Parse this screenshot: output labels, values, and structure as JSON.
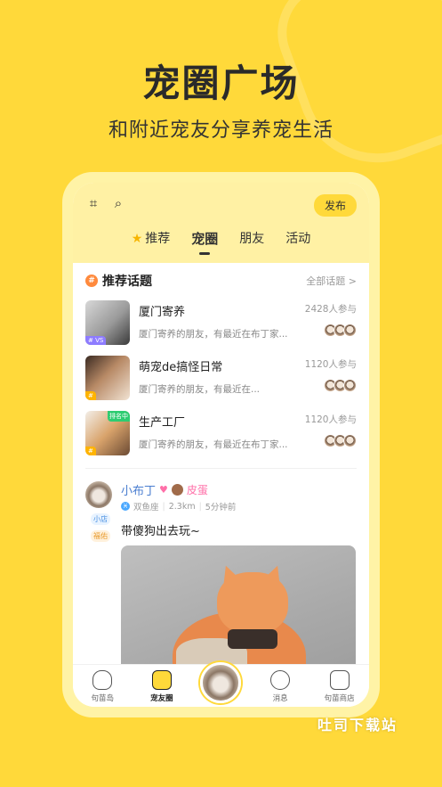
{
  "promo": {
    "title": "宠圈广场",
    "subtitle": "和附近宠友分享养宠生活"
  },
  "header": {
    "scan_icon": "scan-icon",
    "search_icon": "search-icon",
    "publish_label": "发布"
  },
  "tabs": [
    {
      "label": "推荐",
      "icon": "star-icon"
    },
    {
      "label": "宠圈",
      "active": true
    },
    {
      "label": "朋友"
    },
    {
      "label": "活动"
    }
  ],
  "topics_section": {
    "title": "推荐话题",
    "see_all": "全部话题 >",
    "items": [
      {
        "name": "厦门寄养",
        "desc": "厦门寄养的朋友，有最近在布丁家...",
        "count": "2428人参与",
        "tag": "# VS",
        "tag_color": "#8E7CFF"
      },
      {
        "name": "萌宠de搞怪日常",
        "desc": "厦门寄养的朋友，有最近在...",
        "count": "1120人参与",
        "tag": "#",
        "tag_color": "#FFB400"
      },
      {
        "name": "生产工厂",
        "desc": "厦门寄养的朋友，有最近在布丁家...",
        "count": "1120人参与",
        "tag": "#",
        "tag_color": "#FFB400",
        "hot": "排名中"
      }
    ]
  },
  "post": {
    "user_name": "小布丁",
    "partner_name": "皮蛋",
    "zodiac": "双鱼座",
    "distance": "2.3km",
    "time": "5分钟前",
    "badges": [
      "小店",
      "福佑"
    ],
    "text": "带傻狗出去玩~"
  },
  "bottom_nav": [
    {
      "label": "句苗岛",
      "icon": "cat-face-icon"
    },
    {
      "label": "宠友圈",
      "icon": "chat-bubble-icon",
      "active": true
    },
    {
      "label": "",
      "icon": "center-avatar"
    },
    {
      "label": "消息",
      "icon": "message-icon"
    },
    {
      "label": "句苗商店",
      "icon": "store-icon"
    }
  ],
  "watermark": "吐司下载站",
  "colors": {
    "background": "#FFD93A",
    "accent": "#FFD93A",
    "username": "#4A7ED0",
    "partner": "#FF6FA8"
  }
}
